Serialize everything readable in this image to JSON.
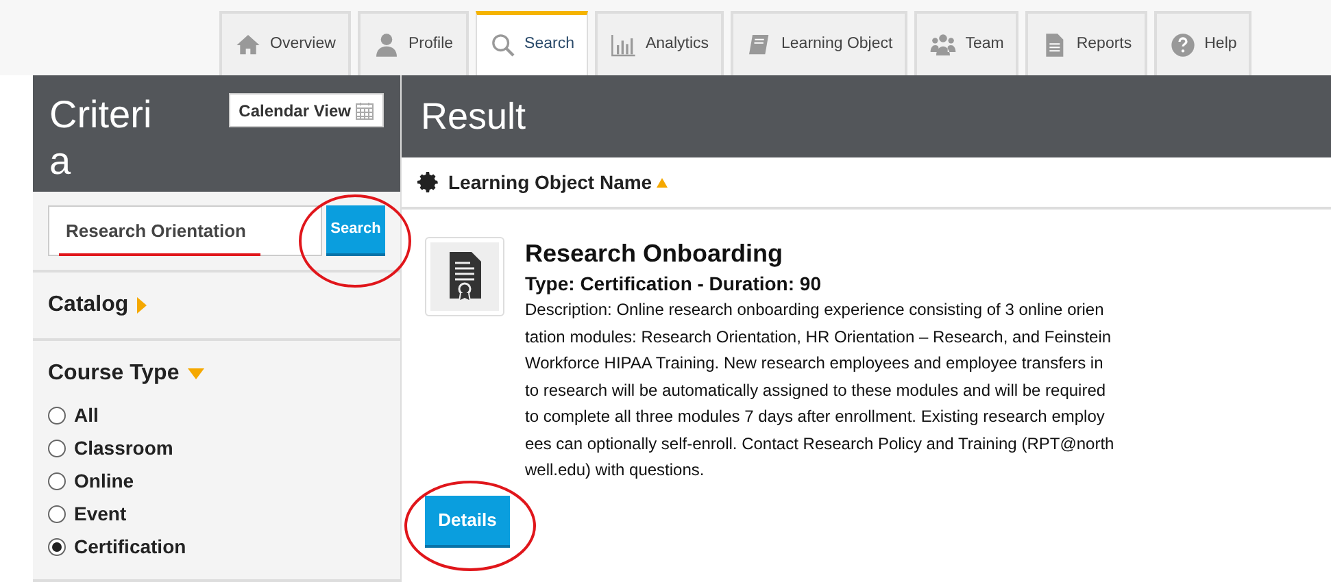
{
  "tabs": [
    {
      "label": "Overview",
      "selected": false
    },
    {
      "label": "Profile",
      "selected": false
    },
    {
      "label": "Search",
      "selected": true
    },
    {
      "label": "Analytics",
      "selected": false
    },
    {
      "label": "Learning Object",
      "selected": false
    },
    {
      "label": "Team",
      "selected": false
    },
    {
      "label": "Reports",
      "selected": false
    },
    {
      "label": "Help",
      "selected": false
    }
  ],
  "criteria": {
    "title": "Criteria",
    "calendar_button": "Calendar View",
    "search_value": "Research Orientation",
    "search_button": "Search",
    "sections": [
      {
        "title": "Catalog",
        "expanded": false
      },
      {
        "title": "Course Type",
        "expanded": true,
        "options": [
          {
            "label": "All",
            "selected": false
          },
          {
            "label": "Classroom",
            "selected": false
          },
          {
            "label": "Online",
            "selected": false
          },
          {
            "label": "Event",
            "selected": false
          },
          {
            "label": "Certification",
            "selected": true
          }
        ]
      }
    ]
  },
  "result": {
    "title": "Result",
    "sort_label": "Learning Object Name",
    "items": [
      {
        "title": "Research Onboarding",
        "meta": "Type: Certification - Duration: 90",
        "description_lines": [
          "Description: Online research onboarding experience consisting of 3 online orien",
          "tation modules: Research Orientation, HR Orientation – Research, and Feinstein",
          "Workforce HIPAA Training. New research employees and employee transfers in",
          "to research will be automatically assigned to these modules and will be required",
          "to complete all three modules 7 days after enrollment. Existing research employ",
          "ees can optionally self-enroll. Contact Research Policy and Training (RPT@north",
          "well.edu) with questions."
        ],
        "button": "Details"
      }
    ]
  }
}
